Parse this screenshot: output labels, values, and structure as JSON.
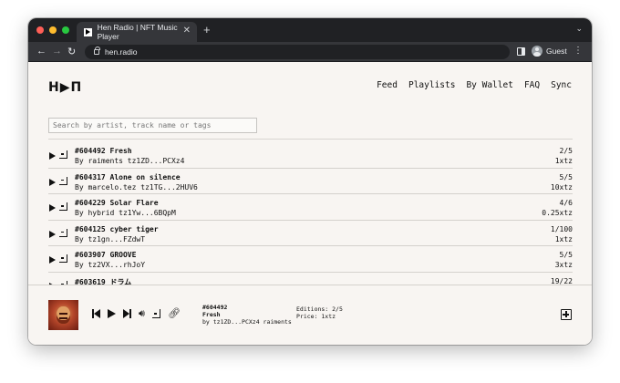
{
  "browser": {
    "tab_title": "Hen Radio | NFT Music Player",
    "tab_close": "✕",
    "new_tab": "+",
    "url": "hen.radio",
    "profile_label": "Guest"
  },
  "site": {
    "logo": "H▶П",
    "nav": [
      "Feed",
      "Playlists",
      "By Wallet",
      "FAQ",
      "Sync"
    ],
    "search_placeholder": "Search by artist, track name or tags"
  },
  "tracks": [
    {
      "title": "#604492 Fresh",
      "artist": "By raiments tz1ZD...PCXz4",
      "editions": "2/5",
      "price": "1xtz"
    },
    {
      "title": "#604317 Alone on silence",
      "artist": "By marcelo.tez tz1TG...2HUV6",
      "editions": "5/5",
      "price": "10xtz"
    },
    {
      "title": "#604229 Solar Flare",
      "artist": "By hybrid tz1Yw...6BQpM",
      "editions": "4/6",
      "price": "0.25xtz"
    },
    {
      "title": "#604125 cyber tiger",
      "artist": "By tz1gn...FZdwT",
      "editions": "1/100",
      "price": "1xtz"
    },
    {
      "title": "#603907 GROOVE",
      "artist": "By tz2VX...rhJoY",
      "editions": "5/5",
      "price": "3xtz"
    },
    {
      "title": "#603619 ドラム",
      "artist": "",
      "editions": "19/22",
      "price": ""
    }
  ],
  "player": {
    "id": "#604492",
    "title": "Fresh",
    "by": "by tz1ZD...PCXz4 raiments",
    "editions": "Editions: 2/5",
    "price": "Price: 1xtz"
  }
}
